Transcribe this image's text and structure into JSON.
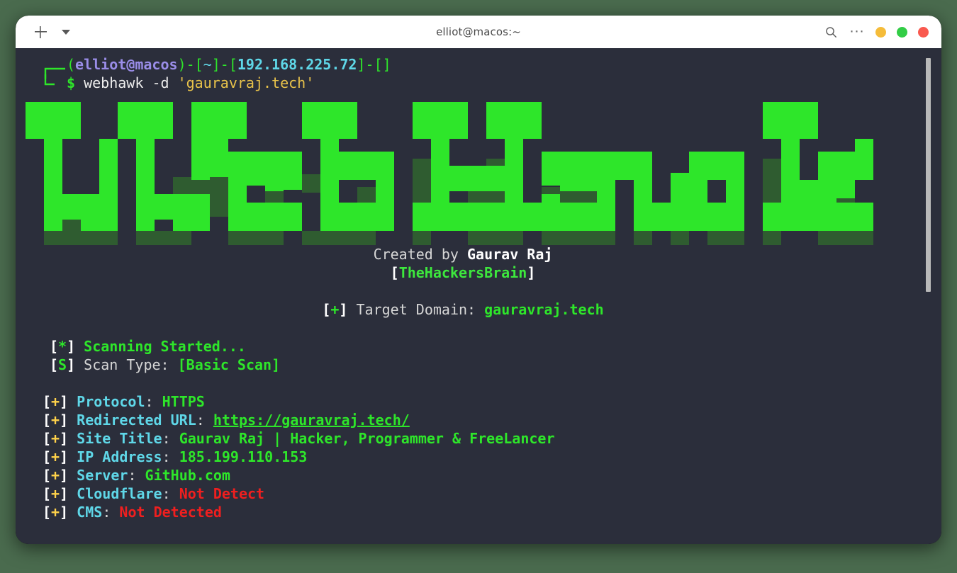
{
  "window": {
    "title": "elliot@macos:~",
    "new_tab_label": "+",
    "tab_menu_label": "▾",
    "search_label": "search",
    "more_label": "···",
    "traffic_lights": [
      {
        "name": "minimize",
        "color": "#f5bc3a"
      },
      {
        "name": "maximize",
        "color": "#32cd46"
      },
      {
        "name": "close",
        "color": "#f9594f"
      }
    ]
  },
  "colors": {
    "terminal_bg": "#2b2e3b",
    "titlebar_bg": "#ffffff",
    "page_bg": "#4a6b4e",
    "banner_fg": "#2ee62a",
    "banner_shadow": "#2f5c30",
    "accent_green": "#2ee62a",
    "accent_cyan": "#5fd7e8",
    "accent_red": "#ef1f1f",
    "accent_yellow": "#ffd24a",
    "accent_purple": "#9a8de8"
  },
  "prompt": {
    "open_paren": "(",
    "user": "elliot",
    "at": "@",
    "host": "macos",
    "close_paren": ")",
    "sep": "-",
    "lb": "[",
    "cwd": "~",
    "rb": "]",
    "ip": "192.168.225.72",
    "empty_brackets": "[]",
    "dollar": "$",
    "command_name": "webhawk",
    "command_flag": "-d",
    "command_arg": "'gauravraj.tech'"
  },
  "banner": {
    "text": "WebHawk",
    "style": "block-ascii-3d"
  },
  "credits": {
    "created_prefix": "Created by ",
    "author": "Gaurav Raj",
    "handle_lb": "[",
    "handle": "TheHackersBrain",
    "handle_rb": "]"
  },
  "target": {
    "lb": "[",
    "mark": "+",
    "rb": "]",
    "label": " Target Domain: ",
    "value": "gauravraj.tech"
  },
  "scan_status": [
    {
      "lb": "[",
      "mark": "*",
      "rb": "]",
      "mark_class": "c-green-b",
      "label": " Scanning Started...",
      "label_class": "c-green-b",
      "value": "",
      "value_class": ""
    },
    {
      "lb": "[",
      "mark": "S",
      "rb": "]",
      "mark_class": "c-green-b",
      "label": " Scan Type: ",
      "label_class": "c-grey",
      "value": "[Basic Scan]",
      "value_class": "c-green-b"
    }
  ],
  "results": [
    {
      "lb": "[",
      "mark": "+",
      "rb": "]",
      "key": " Protocol",
      "colon": ": ",
      "value": "HTTPS",
      "value_class": "c-green-b",
      "underline": false
    },
    {
      "lb": "[",
      "mark": "+",
      "rb": "]",
      "key": " Redirected URL",
      "colon": ": ",
      "value": "https://gauravraj.tech/",
      "value_class": "c-green-b",
      "underline": true
    },
    {
      "lb": "[",
      "mark": "+",
      "rb": "]",
      "key": " Site Title",
      "colon": ": ",
      "value": "Gaurav Raj | Hacker, Programmer & FreeLancer",
      "value_class": "c-green-b",
      "underline": false
    },
    {
      "lb": "[",
      "mark": "+",
      "rb": "]",
      "key": " IP Address",
      "colon": ": ",
      "value": "185.199.110.153",
      "value_class": "c-green-b",
      "underline": false
    },
    {
      "lb": "[",
      "mark": "+",
      "rb": "]",
      "key": " Server",
      "colon": ": ",
      "value": "GitHub.com",
      "value_class": "c-green-b",
      "underline": false
    },
    {
      "lb": "[",
      "mark": "+",
      "rb": "]",
      "key": " Cloudflare",
      "colon": ": ",
      "value": "Not Detect",
      "value_class": "c-red",
      "underline": false
    },
    {
      "lb": "[",
      "mark": "+",
      "rb": "]",
      "key": " CMS",
      "colon": ": ",
      "value": "Not Detected",
      "value_class": "c-red",
      "underline": false
    }
  ]
}
